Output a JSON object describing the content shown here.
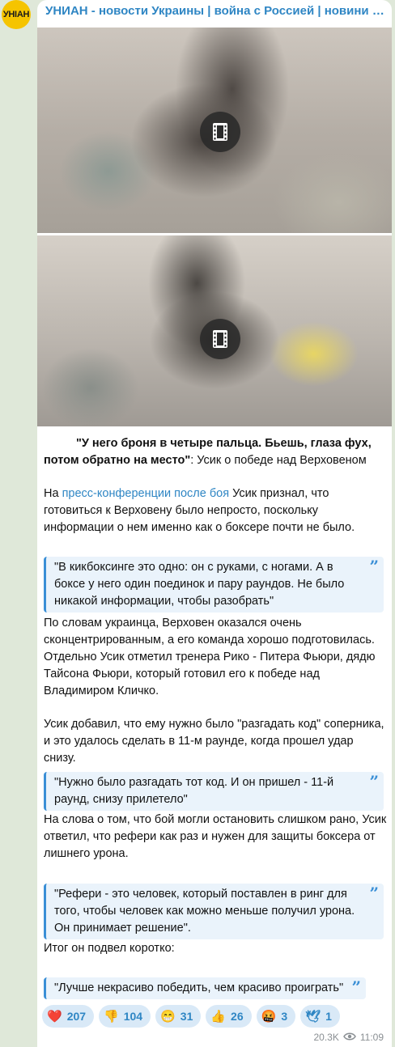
{
  "channel": {
    "avatar_text": "УНІАН",
    "name": "УНИАН - новости Украины | война с Россией | новини України | війна з Росією"
  },
  "media": [
    {
      "kind": "video",
      "icon": "video-icon"
    },
    {
      "kind": "video",
      "icon": "video-icon"
    }
  ],
  "post": {
    "headline_bold": "\"У него броня в четыре пальца. Бьешь, глаза фух, потом обратно на место\"",
    "headline_rest": ": Усик о победе над Верховеном",
    "p1_prefix": "На ",
    "p1_link": "пресс-конференции после боя",
    "p1_rest": " Усик признал, что готовиться к Верховену было непросто, поскольку информации о нем именно как о боксере почти не было.",
    "quote1": "\"В кикбоксинге это одно: он с руками, с ногами. А в боксе у него один поединок и пару раундов. Не было никакой информации, чтобы разобрать\"",
    "p2": "По словам украинца, Верховен оказался очень сконцентрированным, а его команда хорошо подготовилась. Отдельно Усик отметил тренера Рико - Питера Фьюри, дядю Тайсона Фьюри, который готовил его к победе над Владимиром Кличко.",
    "p3": "Усик добавил, что ему нужно было \"разгадать код\" соперника, и это удалось сделать в 11-м раунде, когда прошел удар снизу.",
    "quote2": "\"Нужно было разгадать тот код. И он пришел - 11-й раунд, снизу прилетело\"",
    "p4": "На слова о том, что бой могли остановить слишком рано, Усик ответил, что рефери как раз и нужен для защиты боксера от лишнего урона.",
    "quote3_line1": "\"Рефери - это человек, который поставлен в ринг для того, чтобы человек как можно меньше получил урона.",
    "quote3_line2": "Он принимает решение\".",
    "p5": "Итог он подвел коротко:",
    "quote4": "\"Лучше некрасиво победить, чем красиво проиграть\""
  },
  "reactions": [
    {
      "emoji": "❤️",
      "icon": "heart-icon",
      "count": "207"
    },
    {
      "emoji": "👎",
      "icon": "thumbs-down-icon",
      "count": "104"
    },
    {
      "emoji": "😁",
      "icon": "grin-icon",
      "count": "31"
    },
    {
      "emoji": "👍",
      "icon": "thumbs-up-icon",
      "count": "26"
    },
    {
      "emoji": "🤬",
      "icon": "angry-face-icon",
      "count": "3"
    },
    {
      "emoji": "🕊",
      "icon": "dove-icon",
      "count": "1"
    }
  ],
  "meta": {
    "views": "20.3K",
    "time": "11:09"
  },
  "colors": {
    "accent": "#2f86c4",
    "quote_bg": "#eaf3fb",
    "quote_bar": "#3a8fd6",
    "background": "#dfe8d9"
  }
}
